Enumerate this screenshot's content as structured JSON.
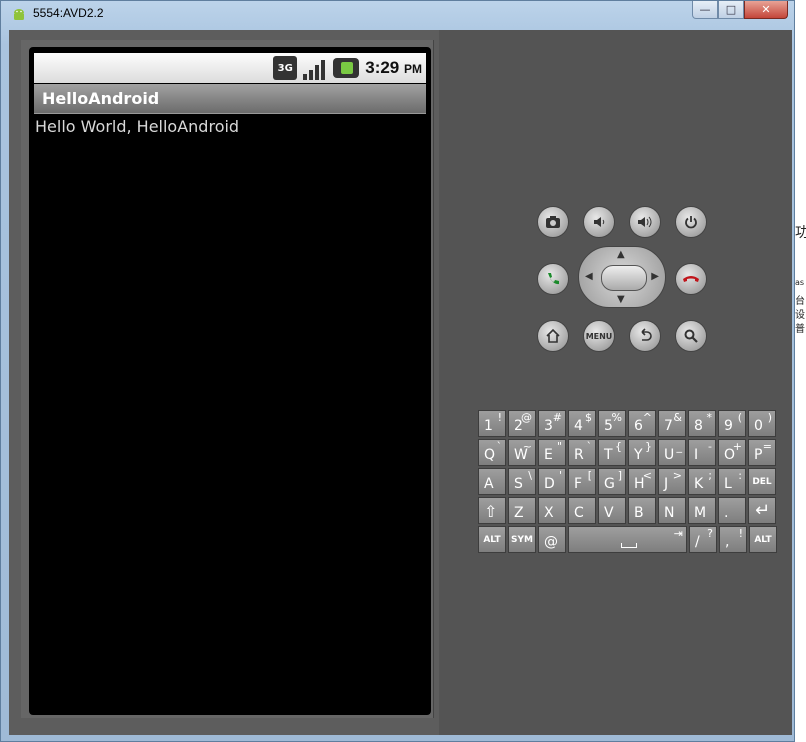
{
  "window": {
    "title": "5554:AVD2.2",
    "minimize": "—",
    "maximize": "□",
    "close": "✕"
  },
  "status_bar": {
    "network": "3G",
    "time": "3:29",
    "ampm": "PM"
  },
  "app": {
    "title": "HelloAndroid",
    "content": "Hello World, HelloAndroid"
  },
  "controls": {
    "row1": [
      "camera-icon",
      "volume-down-icon",
      "volume-up-icon",
      "power-icon"
    ],
    "row3_menu": "MENU"
  },
  "keyboard": {
    "row1": [
      [
        "1",
        "!"
      ],
      [
        "2",
        "@"
      ],
      [
        "3",
        "#"
      ],
      [
        "4",
        "$"
      ],
      [
        "5",
        "%"
      ],
      [
        "6",
        "^"
      ],
      [
        "7",
        "&"
      ],
      [
        "8",
        "*"
      ],
      [
        "9",
        "("
      ],
      [
        "0",
        ")"
      ]
    ],
    "row2": [
      [
        "Q",
        "`"
      ],
      [
        "W",
        "~"
      ],
      [
        "E",
        "\""
      ],
      [
        "R",
        "`"
      ],
      [
        "T",
        "{"
      ],
      [
        "Y",
        "}"
      ],
      [
        "U",
        "_"
      ],
      [
        "I",
        "-"
      ],
      [
        "O",
        "+"
      ],
      [
        "P",
        "="
      ]
    ],
    "row3": [
      [
        "A",
        ""
      ],
      [
        "S",
        "\\"
      ],
      [
        "D",
        "'"
      ],
      [
        "F",
        "["
      ],
      [
        "G",
        "]"
      ],
      [
        "H",
        "<"
      ],
      [
        "J",
        ">"
      ],
      [
        "K",
        ";"
      ],
      [
        "L",
        ":"
      ],
      [
        "DEL",
        ""
      ]
    ],
    "row4": [
      [
        "⇧",
        ""
      ],
      [
        "Z",
        ""
      ],
      [
        "X",
        ""
      ],
      [
        "C",
        ""
      ],
      [
        "V",
        ""
      ],
      [
        "B",
        ""
      ],
      [
        "N",
        ""
      ],
      [
        "M",
        ""
      ],
      [
        ".",
        ""
      ],
      [
        "↵",
        ""
      ]
    ],
    "row5": {
      "alt_left": "ALT",
      "sym": "SYM",
      "at": "@",
      "space_alt": "⇥",
      "slash": "/",
      "slash_alt": "?",
      "comma": ",",
      "comma_alt": "!",
      "alt_right": "ALT"
    }
  },
  "background_window": {
    "glyphs": [
      "功",
      "as",
      "台",
      "设",
      "普"
    ]
  }
}
